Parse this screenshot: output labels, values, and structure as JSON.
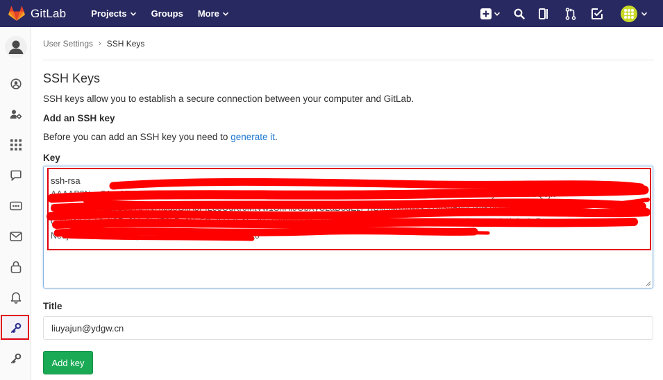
{
  "navbar": {
    "brand": "GitLab",
    "links": [
      {
        "label": "Projects"
      },
      {
        "label": "Groups"
      },
      {
        "label": "More"
      }
    ]
  },
  "breadcrumb": {
    "parent": "User Settings",
    "current": "SSH Keys"
  },
  "page": {
    "title": "SSH Keys",
    "description": "SSH keys allow you to establish a secure connection between your computer and GitLab.",
    "add_heading": "Add an SSH key",
    "before_text": "Before you can add an SSH key you need to ",
    "generate_link": "generate it",
    "before_suffix": "."
  },
  "form": {
    "key_label": "Key",
    "key_first_line": "ssh-rsa",
    "title_label": "Title",
    "title_value": "liuyajun@ydgw.cn",
    "submit_label": "Add key"
  },
  "colors": {
    "navbar": "#292961",
    "submit": "#1aaa55",
    "link": "#1f78d1",
    "annotation_red": "#e1000f"
  }
}
